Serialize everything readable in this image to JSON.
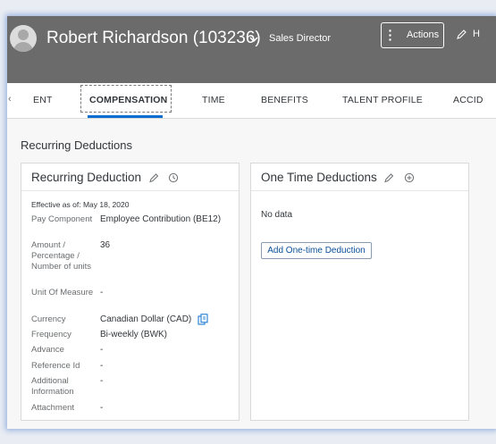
{
  "header": {
    "employee_name": "Robert Richardson (103236)",
    "employee_title": "Sales Director",
    "actions_label": "Actions",
    "edit_label": "H"
  },
  "tabs": {
    "scroll_left": "‹",
    "items": [
      {
        "label": "ENT"
      },
      {
        "label": "COMPENSATION",
        "selected": true
      },
      {
        "label": "TIME"
      },
      {
        "label": "BENEFITS"
      },
      {
        "label": "TALENT PROFILE"
      },
      {
        "label": "ACCID"
      }
    ]
  },
  "section": {
    "title": "Recurring Deductions"
  },
  "recurring_card": {
    "title": "Recurring Deduction",
    "effective": "Effective as of: May 18, 2020",
    "fields": [
      {
        "label": "Pay Component",
        "value": "Employee Contribution (BE12)"
      },
      {
        "label": "Amount / Percentage / Number of units",
        "value": "36"
      },
      {
        "label": "Unit Of Measure",
        "value": "-"
      },
      {
        "label": "Currency",
        "value": "Canadian Dollar (CAD)"
      },
      {
        "label": "Frequency",
        "value": "Bi-weekly (BWK)"
      },
      {
        "label": "Advance",
        "value": "-"
      },
      {
        "label": "Reference Id",
        "value": "-"
      },
      {
        "label": "Additional Information",
        "value": "-"
      },
      {
        "label": "Attachment",
        "value": "-"
      }
    ]
  },
  "onetime_card": {
    "title": "One Time Deductions",
    "empty_text": "No data",
    "add_button": "Add One-time Deduction"
  },
  "icons": {
    "avatar": "person-placeholder",
    "chevron": "chevron-down-icon",
    "actions": "vertical-dots-icon",
    "edit": "pencil-icon",
    "history": "clock-history-icon",
    "add": "circle-plus-icon",
    "currency_info": "copy-info-icon"
  },
  "colors": {
    "header_bg": "#6b6b6b",
    "accent": "#0a6ed1",
    "button_text": "#0a4f9a"
  }
}
